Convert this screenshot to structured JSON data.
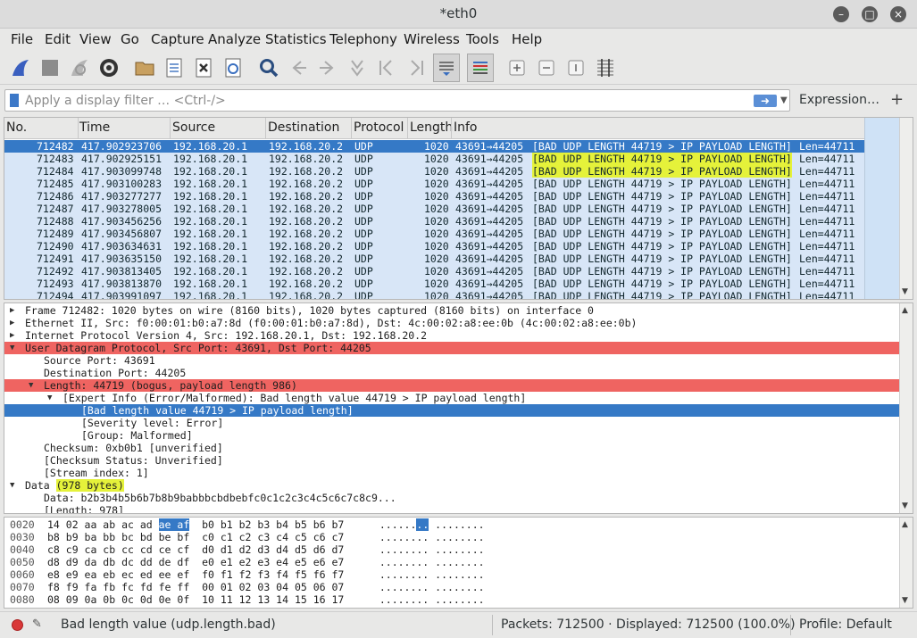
{
  "window": {
    "title": "*eth0"
  },
  "menu": [
    "File",
    "Edit",
    "View",
    "Go",
    "Capture",
    "Analyze",
    "Statistics",
    "Telephony",
    "Wireless",
    "Tools",
    "Help"
  ],
  "toolbar_icons": [
    "shark-fin-start-icon",
    "stop-icon",
    "restart-icon",
    "options-gear-icon",
    "open-folder-icon",
    "save-file-icon",
    "close-file-icon",
    "reload-icon",
    "find-icon",
    "back-icon",
    "forward-icon",
    "go-to-packet-icon",
    "first-packet-icon",
    "last-packet-icon",
    "autoscroll-icon",
    "colorize-icon",
    "zoom-in-icon",
    "zoom-out-icon",
    "normal-size-icon",
    "resize-columns-icon"
  ],
  "filter": {
    "placeholder": "Apply a display filter … <Ctrl-/>",
    "expression_label": "Expression…",
    "plus_label": "+"
  },
  "packet_list": {
    "columns": [
      "No.",
      "Time",
      "Source",
      "Destination",
      "Protocol",
      "Length",
      "Info"
    ],
    "rows": [
      {
        "no": "712482",
        "time": "417.902923706",
        "src": "192.168.20.1",
        "dst": "192.168.20.2",
        "proto": "UDP",
        "len": "1020",
        "ports": "43691→44205",
        "info": "[BAD UDP LENGTH 44719 > IP PAYLOAD LENGTH]",
        "tail": "Len=44711"
      },
      {
        "no": "712483",
        "time": "417.902925151",
        "src": "192.168.20.1",
        "dst": "192.168.20.2",
        "proto": "UDP",
        "len": "1020",
        "ports": "43691→44205",
        "info": "[BAD UDP LENGTH 44719 > IP PAYLOAD LENGTH]",
        "tail": "Len=44711"
      },
      {
        "no": "712484",
        "time": "417.903099748",
        "src": "192.168.20.1",
        "dst": "192.168.20.2",
        "proto": "UDP",
        "len": "1020",
        "ports": "43691→44205",
        "info": "[BAD UDP LENGTH 44719 > IP PAYLOAD LENGTH]",
        "tail": "Len=44711"
      },
      {
        "no": "712485",
        "time": "417.903100283",
        "src": "192.168.20.1",
        "dst": "192.168.20.2",
        "proto": "UDP",
        "len": "1020",
        "ports": "43691→44205",
        "info": "[BAD UDP LENGTH 44719 > IP PAYLOAD LENGTH]",
        "tail": "Len=44711"
      },
      {
        "no": "712486",
        "time": "417.903277277",
        "src": "192.168.20.1",
        "dst": "192.168.20.2",
        "proto": "UDP",
        "len": "1020",
        "ports": "43691→44205",
        "info": "[BAD UDP LENGTH 44719 > IP PAYLOAD LENGTH]",
        "tail": "Len=44711"
      },
      {
        "no": "712487",
        "time": "417.903278005",
        "src": "192.168.20.1",
        "dst": "192.168.20.2",
        "proto": "UDP",
        "len": "1020",
        "ports": "43691→44205",
        "info": "[BAD UDP LENGTH 44719 > IP PAYLOAD LENGTH]",
        "tail": "Len=44711"
      },
      {
        "no": "712488",
        "time": "417.903456256",
        "src": "192.168.20.1",
        "dst": "192.168.20.2",
        "proto": "UDP",
        "len": "1020",
        "ports": "43691→44205",
        "info": "[BAD UDP LENGTH 44719 > IP PAYLOAD LENGTH]",
        "tail": "Len=44711"
      },
      {
        "no": "712489",
        "time": "417.903456807",
        "src": "192.168.20.1",
        "dst": "192.168.20.2",
        "proto": "UDP",
        "len": "1020",
        "ports": "43691→44205",
        "info": "[BAD UDP LENGTH 44719 > IP PAYLOAD LENGTH]",
        "tail": "Len=44711"
      },
      {
        "no": "712490",
        "time": "417.903634631",
        "src": "192.168.20.1",
        "dst": "192.168.20.2",
        "proto": "UDP",
        "len": "1020",
        "ports": "43691→44205",
        "info": "[BAD UDP LENGTH 44719 > IP PAYLOAD LENGTH]",
        "tail": "Len=44711"
      },
      {
        "no": "712491",
        "time": "417.903635150",
        "src": "192.168.20.1",
        "dst": "192.168.20.2",
        "proto": "UDP",
        "len": "1020",
        "ports": "43691→44205",
        "info": "[BAD UDP LENGTH 44719 > IP PAYLOAD LENGTH]",
        "tail": "Len=44711"
      },
      {
        "no": "712492",
        "time": "417.903813405",
        "src": "192.168.20.1",
        "dst": "192.168.20.2",
        "proto": "UDP",
        "len": "1020",
        "ports": "43691→44205",
        "info": "[BAD UDP LENGTH 44719 > IP PAYLOAD LENGTH]",
        "tail": "Len=44711"
      },
      {
        "no": "712493",
        "time": "417.903813870",
        "src": "192.168.20.1",
        "dst": "192.168.20.2",
        "proto": "UDP",
        "len": "1020",
        "ports": "43691→44205",
        "info": "[BAD UDP LENGTH 44719 > IP PAYLOAD LENGTH]",
        "tail": "Len=44711"
      },
      {
        "no": "712494",
        "time": "417.903991097",
        "src": "192.168.20.1",
        "dst": "192.168.20.2",
        "proto": "UDP",
        "len": "1020",
        "ports": "43691→44205",
        "info": "[BAD UDP LENGTH 44719 > IP PAYLOAD LENGTH]",
        "tail": "Len=44711"
      }
    ],
    "selected_row": 0,
    "highlighted_rows": [
      1,
      2
    ],
    "row_color": "#d8e6f7",
    "selected_color": "#3579c6",
    "highlight_color": "#e5f23a"
  },
  "details": [
    {
      "text": "Frame 712482: 1020 bytes on wire (8160 bits), 1020 bytes captured (8160 bits) on interface 0",
      "depth": 0,
      "twisty": "collapsed",
      "style": ""
    },
    {
      "text": "Ethernet II, Src: f0:00:01:b0:a7:8d (f0:00:01:b0:a7:8d), Dst: 4c:00:02:a8:ee:0b (4c:00:02:a8:ee:0b)",
      "depth": 0,
      "twisty": "collapsed",
      "style": ""
    },
    {
      "text": "Internet Protocol Version 4, Src: 192.168.20.1, Dst: 192.168.20.2",
      "depth": 0,
      "twisty": "collapsed",
      "style": ""
    },
    {
      "text": "User Datagram Protocol, Src Port: 43691, Dst Port: 44205",
      "depth": 0,
      "twisty": "expanded",
      "style": "err"
    },
    {
      "text": "Source Port: 43691",
      "depth": 1,
      "twisty": "",
      "style": ""
    },
    {
      "text": "Destination Port: 44205",
      "depth": 1,
      "twisty": "",
      "style": ""
    },
    {
      "text": "Length: 44719 (bogus, payload length 986)",
      "depth": 1,
      "twisty": "expanded",
      "style": "err"
    },
    {
      "text": "[Expert Info (Error/Malformed): Bad length value 44719 > IP payload length]",
      "depth": 2,
      "twisty": "expanded",
      "style": ""
    },
    {
      "text": "[Bad length value 44719 > IP payload length]",
      "depth": 3,
      "twisty": "",
      "style": "sel"
    },
    {
      "text": "[Severity level: Error]",
      "depth": 3,
      "twisty": "",
      "style": ""
    },
    {
      "text": "[Group: Malformed]",
      "depth": 3,
      "twisty": "",
      "style": ""
    },
    {
      "text": "Checksum: 0xb0b1 [unverified]",
      "depth": 1,
      "twisty": "",
      "style": ""
    },
    {
      "text": "[Checksum Status: Unverified]",
      "depth": 1,
      "twisty": "",
      "style": ""
    },
    {
      "text": "[Stream index: 1]",
      "depth": 1,
      "twisty": "",
      "style": ""
    },
    {
      "text": "Data ",
      "highlight": "(978 bytes)",
      "depth": 0,
      "twisty": "expanded",
      "style": ""
    },
    {
      "text": "Data: b2b3b4b5b6b7b8b9babbbcbdbebfc0c1c2c3c4c5c6c7c8c9...",
      "depth": 1,
      "twisty": "",
      "style": ""
    },
    {
      "text": "[Length: 978]",
      "depth": 1,
      "twisty": "",
      "style": ""
    }
  ],
  "bytes": [
    {
      "off": "0020",
      "pre": "14 02 aa ab ac ad ",
      "sel": "ae af",
      "post": "  b0 b1 b2 b3 b4 b5 b6 b7",
      "asc_pre": "  ......",
      "asc_sel": "..",
      "asc_post": " ........"
    },
    {
      "off": "0030",
      "pre": "b8 b9 ba bb bc bd be bf  c0 c1 c2 c3 c4 c5 c6 c7",
      "sel": "",
      "post": "",
      "asc_pre": "  ........ ........",
      "asc_sel": "",
      "asc_post": ""
    },
    {
      "off": "0040",
      "pre": "c8 c9 ca cb cc cd ce cf  d0 d1 d2 d3 d4 d5 d6 d7",
      "sel": "",
      "post": "",
      "asc_pre": "  ........ ........",
      "asc_sel": "",
      "asc_post": ""
    },
    {
      "off": "0050",
      "pre": "d8 d9 da db dc dd de df  e0 e1 e2 e3 e4 e5 e6 e7",
      "sel": "",
      "post": "",
      "asc_pre": "  ........ ........",
      "asc_sel": "",
      "asc_post": ""
    },
    {
      "off": "0060",
      "pre": "e8 e9 ea eb ec ed ee ef  f0 f1 f2 f3 f4 f5 f6 f7",
      "sel": "",
      "post": "",
      "asc_pre": "  ........ ........",
      "asc_sel": "",
      "asc_post": ""
    },
    {
      "off": "0070",
      "pre": "f8 f9 fa fb fc fd fe ff  00 01 02 03 04 05 06 07",
      "sel": "",
      "post": "",
      "asc_pre": "  ........ ........",
      "asc_sel": "",
      "asc_post": ""
    },
    {
      "off": "0080",
      "pre": "08 09 0a 0b 0c 0d 0e 0f  10 11 12 13 14 15 16 17",
      "sel": "",
      "post": "",
      "asc_pre": "  ........ ........",
      "asc_sel": "",
      "asc_post": ""
    }
  ],
  "status": {
    "message": "Bad length value (udp.length.bad)",
    "packets": "Packets: 712500 · Displayed: 712500 (100.0%)",
    "profile": "Profile: Default"
  }
}
